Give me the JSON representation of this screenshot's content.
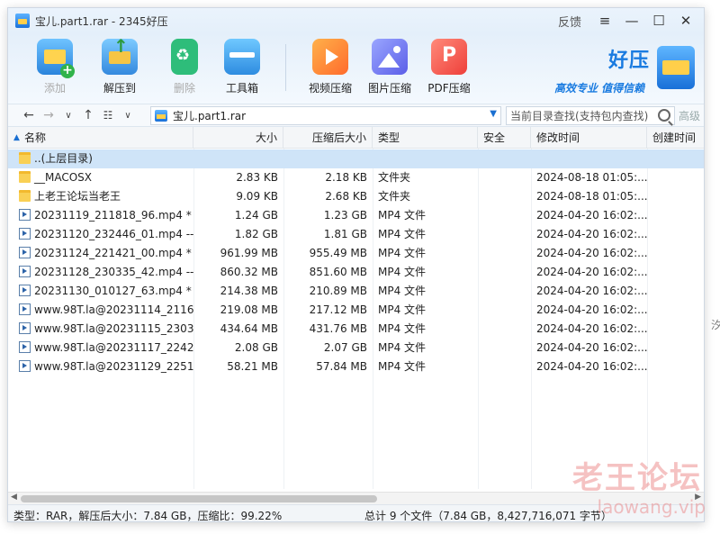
{
  "window": {
    "title": "宝儿.part1.rar - 2345好压",
    "feedback": "反馈",
    "menu_icon": "≡",
    "minimize_icon": "—",
    "maximize_icon": "☐",
    "close_icon": "✕"
  },
  "toolbar": {
    "add": "添加",
    "extract": "解压到",
    "delete": "删除",
    "tools": "工具箱",
    "video": "视频压缩",
    "image": "图片压缩",
    "pdf": "PDF压缩",
    "brand_name": "好压",
    "brand_slogan": "高效专业  值得信赖"
  },
  "nav": {
    "path": "宝儿.part1.rar",
    "search_placeholder": "当前目录查找(支持包内查找)",
    "advanced": "高级"
  },
  "columns": [
    "名称",
    "大小",
    "压缩后大小",
    "类型",
    "安全",
    "修改时间",
    "创建时间"
  ],
  "rows": [
    {
      "name": "..(上层目录)",
      "icon": "folder",
      "size": "",
      "packed": "",
      "type": "",
      "modified": ""
    },
    {
      "name": "__MACOSX",
      "icon": "folder",
      "size": "2.83 KB",
      "packed": "2.18 KB",
      "type": "文件夹",
      "modified": "2024-08-18 01:05:..."
    },
    {
      "name": "上老王论坛当老王",
      "icon": "folder",
      "size": "9.09 KB",
      "packed": "2.68 KB",
      "type": "文件夹",
      "modified": "2024-08-18 01:05:..."
    },
    {
      "name": "20231119_211818_96.mp4 *",
      "icon": "video",
      "size": "1.24 GB",
      "packed": "1.23 GB",
      "type": "MP4 文件",
      "modified": "2024-04-20 16:02:..."
    },
    {
      "name": "20231120_232446_01.mp4 --...",
      "icon": "video",
      "size": "1.82 GB",
      "packed": "1.81 GB",
      "type": "MP4 文件",
      "modified": "2024-04-20 16:02:..."
    },
    {
      "name": "20231124_221421_00.mp4 *",
      "icon": "video",
      "size": "961.99 MB",
      "packed": "955.49 MB",
      "type": "MP4 文件",
      "modified": "2024-04-20 16:02:..."
    },
    {
      "name": "20231128_230335_42.mp4 --...",
      "icon": "video",
      "size": "860.32 MB",
      "packed": "851.60 MB",
      "type": "MP4 文件",
      "modified": "2024-04-20 16:02:..."
    },
    {
      "name": "20231130_010127_63.mp4 *",
      "icon": "video",
      "size": "214.38 MB",
      "packed": "210.89 MB",
      "type": "MP4 文件",
      "modified": "2024-04-20 16:02:..."
    },
    {
      "name": "www.98T.la@20231114_2116...",
      "icon": "video",
      "size": "219.08 MB",
      "packed": "217.12 MB",
      "type": "MP4 文件",
      "modified": "2024-04-20 16:02:..."
    },
    {
      "name": "www.98T.la@20231115_2303...",
      "icon": "video",
      "size": "434.64 MB",
      "packed": "431.76 MB",
      "type": "MP4 文件",
      "modified": "2024-04-20 16:02:..."
    },
    {
      "name": "www.98T.la@20231117_2242...",
      "icon": "video",
      "size": "2.08 GB",
      "packed": "2.07 GB",
      "type": "MP4 文件",
      "modified": "2024-04-20 16:02:..."
    },
    {
      "name": "www.98T.la@20231129_2251...",
      "icon": "video",
      "size": "58.21 MB",
      "packed": "57.84 MB",
      "type": "MP4 文件",
      "modified": "2024-04-20 16:02:..."
    }
  ],
  "status": {
    "left": "类型：RAR，解压后大小：7.84 GB，压缩比：99.22%",
    "right": "总计 9 个文件（7.84 GB，8,427,716,071 字节）"
  },
  "watermark": {
    "big": "老王论坛",
    "small": "laowang.vip"
  },
  "edge_glyph": "汐"
}
